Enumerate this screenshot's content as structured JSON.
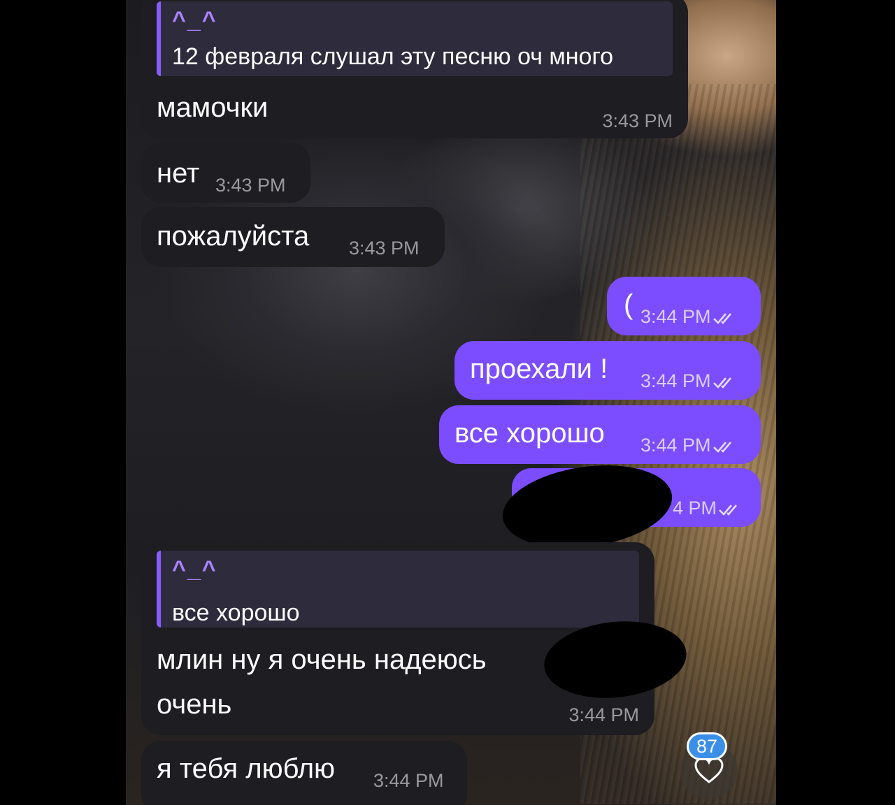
{
  "messages": [
    {
      "direction": "incoming",
      "reply": {
        "author": "^_^",
        "text": "12 февраля слушал эту песню оч много"
      },
      "text": "мамочки",
      "time": "3:43 PM"
    },
    {
      "direction": "incoming",
      "text": "нет",
      "time": "3:43 PM"
    },
    {
      "direction": "incoming",
      "text": "пожалуйста",
      "time": "3:43 PM"
    },
    {
      "direction": "outgoing",
      "text": "(",
      "time": "3:44 PM",
      "status": "read"
    },
    {
      "direction": "outgoing",
      "text": "проехали !",
      "time": "3:44 PM",
      "status": "read"
    },
    {
      "direction": "outgoing",
      "text": "все хорошо",
      "time": "3:44 PM",
      "status": "read"
    },
    {
      "direction": "outgoing",
      "text": "",
      "time": "4 PM",
      "status": "read",
      "redacted": true
    },
    {
      "direction": "incoming",
      "reply": {
        "author": "^_^",
        "text": "все хорошо"
      },
      "text_line1": "млин ну я очень надеюсь",
      "text_line2": "очень",
      "time": "3:44 PM",
      "redacted": true
    },
    {
      "direction": "incoming",
      "text": "я тебя люблю",
      "time": "3:44 PM"
    }
  ],
  "reaction": {
    "icon": "heart-icon",
    "count": "87"
  },
  "colors": {
    "incoming_bubble": "#1d1d22",
    "outgoing_bubble": "#7b4dff",
    "reply_bar": "#8a5cff",
    "badge": "#3b8fe8"
  }
}
